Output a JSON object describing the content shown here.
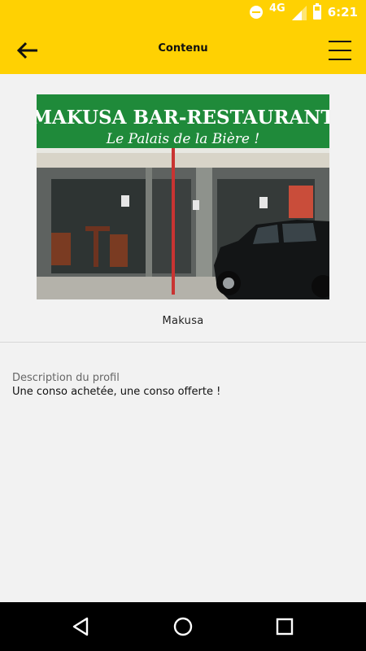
{
  "status_bar": {
    "network": "4G",
    "time": "6:21"
  },
  "app_bar": {
    "title": "Contenu",
    "back_icon": "arrow-left-icon",
    "menu_icon": "hamburger-menu-icon"
  },
  "content": {
    "photo": {
      "sign_title": "MAKUSA BAR-RESTAURANT",
      "sign_slogan": "Le Palais de la Bière !"
    },
    "caption": "Makusa",
    "description_label": "Description du profil",
    "description_text": "Une conso achetée, une conso offerte !"
  },
  "colors": {
    "accent": "#ffd102",
    "background": "#f2f2f2",
    "nav_bar": "#000000"
  },
  "nav_bar": {
    "back_icon": "triangle-back-icon",
    "home_icon": "circle-home-icon",
    "recents_icon": "square-recents-icon"
  }
}
